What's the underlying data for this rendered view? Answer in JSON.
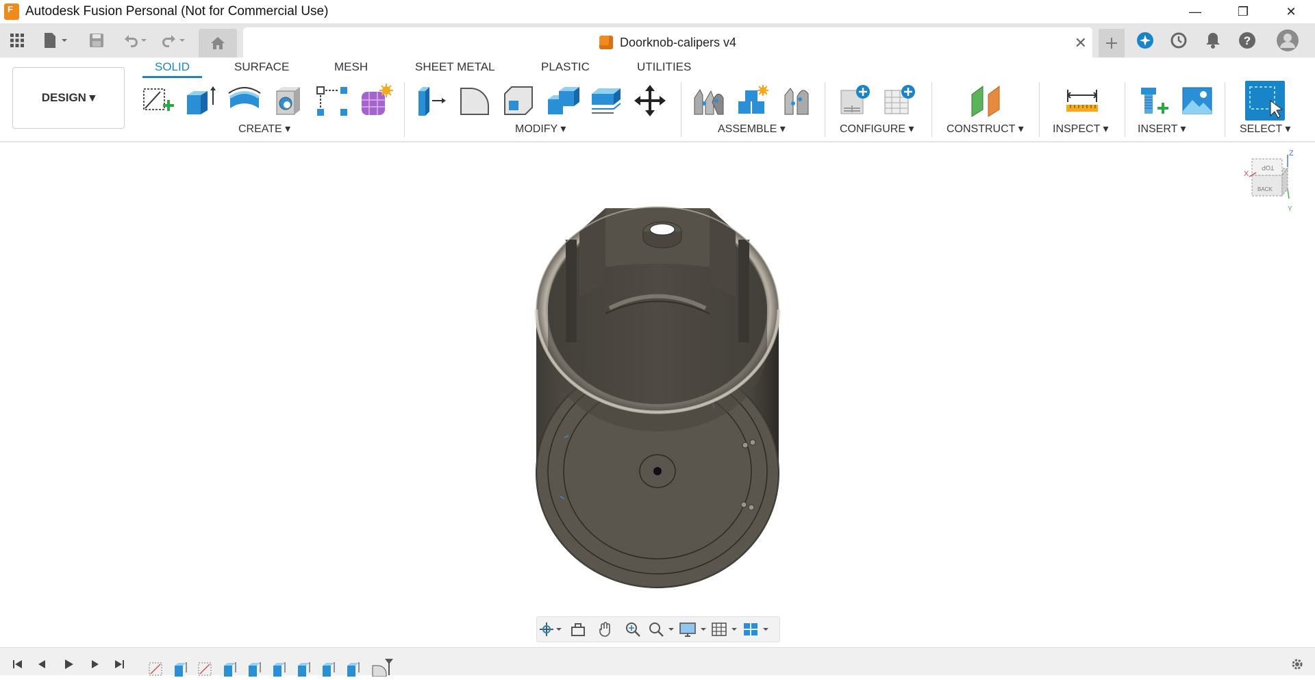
{
  "app": {
    "title": "Autodesk Fusion Personal (Not for Commercial Use)",
    "logo_letter": "F"
  },
  "window_controls": {
    "minimize": "—",
    "restore": "❐",
    "close": "✕"
  },
  "document": {
    "title": "Doorknob-calipers v4",
    "close": "✕"
  },
  "ribbon": {
    "tabs": [
      "SOLID",
      "SURFACE",
      "MESH",
      "SHEET METAL",
      "PLASTIC",
      "UTILITIES"
    ],
    "active_tab": "SOLID",
    "workspace": "DESIGN ▾",
    "groups": {
      "create": "CREATE ▾",
      "modify": "MODIFY ▾",
      "assemble": "ASSEMBLE ▾",
      "configure": "CONFIGURE ▾",
      "construct": "CONSTRUCT ▾",
      "inspect": "INSPECT ▾",
      "insert": "INSERT ▾",
      "select": "SELECT ▾"
    }
  },
  "viewcube": {
    "top": "TOP",
    "back": "BACK",
    "z": "Z",
    "x": "X",
    "y": "Y"
  },
  "colors": {
    "accent": "#1a84c8",
    "brand": "#f08a1c",
    "model": "#5a554d"
  }
}
